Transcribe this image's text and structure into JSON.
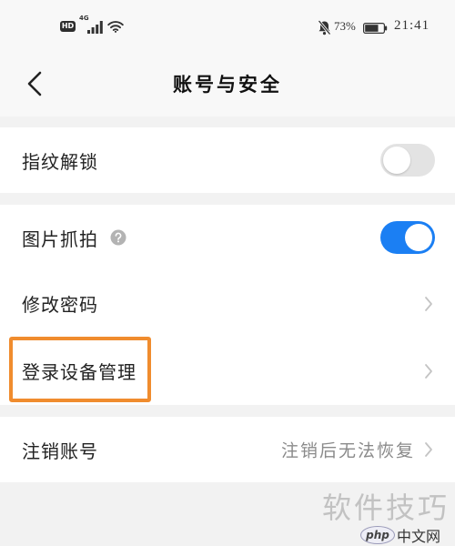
{
  "status_bar": {
    "hd_badge": "HD",
    "network_type": "4G",
    "signal_icon": "signal-bars-icon",
    "wifi_icon": "wifi-icon",
    "mute_icon": "bell-off-icon",
    "battery_percent": "73%",
    "battery_level": 0.73,
    "battery_icon": "battery-icon",
    "time": "21:41"
  },
  "header": {
    "back_icon": "chevron-left-icon",
    "title": "账号与安全"
  },
  "settings": {
    "fingerprint_unlock": {
      "label": "指纹解锁",
      "toggle_on": false
    },
    "photo_capture": {
      "label": "图片抓拍",
      "help_icon": "question-circle-icon",
      "toggle_on": true
    },
    "change_password": {
      "label": "修改密码",
      "chevron_icon": "chevron-right-icon"
    },
    "login_device_management": {
      "label": "登录设备管理",
      "chevron_icon": "chevron-right-icon",
      "highlighted": true
    },
    "cancel_account": {
      "label": "注销账号",
      "hint": "注销后无法恢复",
      "chevron_icon": "chevron-right-icon"
    }
  },
  "watermark": {
    "text": "软件技巧",
    "logo_text": "php",
    "site_name": "中文网"
  },
  "colors": {
    "accent": "#1b7ff3",
    "toggle_off": "#e3e3e3",
    "highlight": "#f08c2e",
    "page_background": "#f2f2f2",
    "header_background": "#f8f8f8",
    "row_background": "#ffffff",
    "text_primary": "#222222",
    "text_secondary": "#8a8a8a",
    "chevron": "#c4c4c4"
  }
}
